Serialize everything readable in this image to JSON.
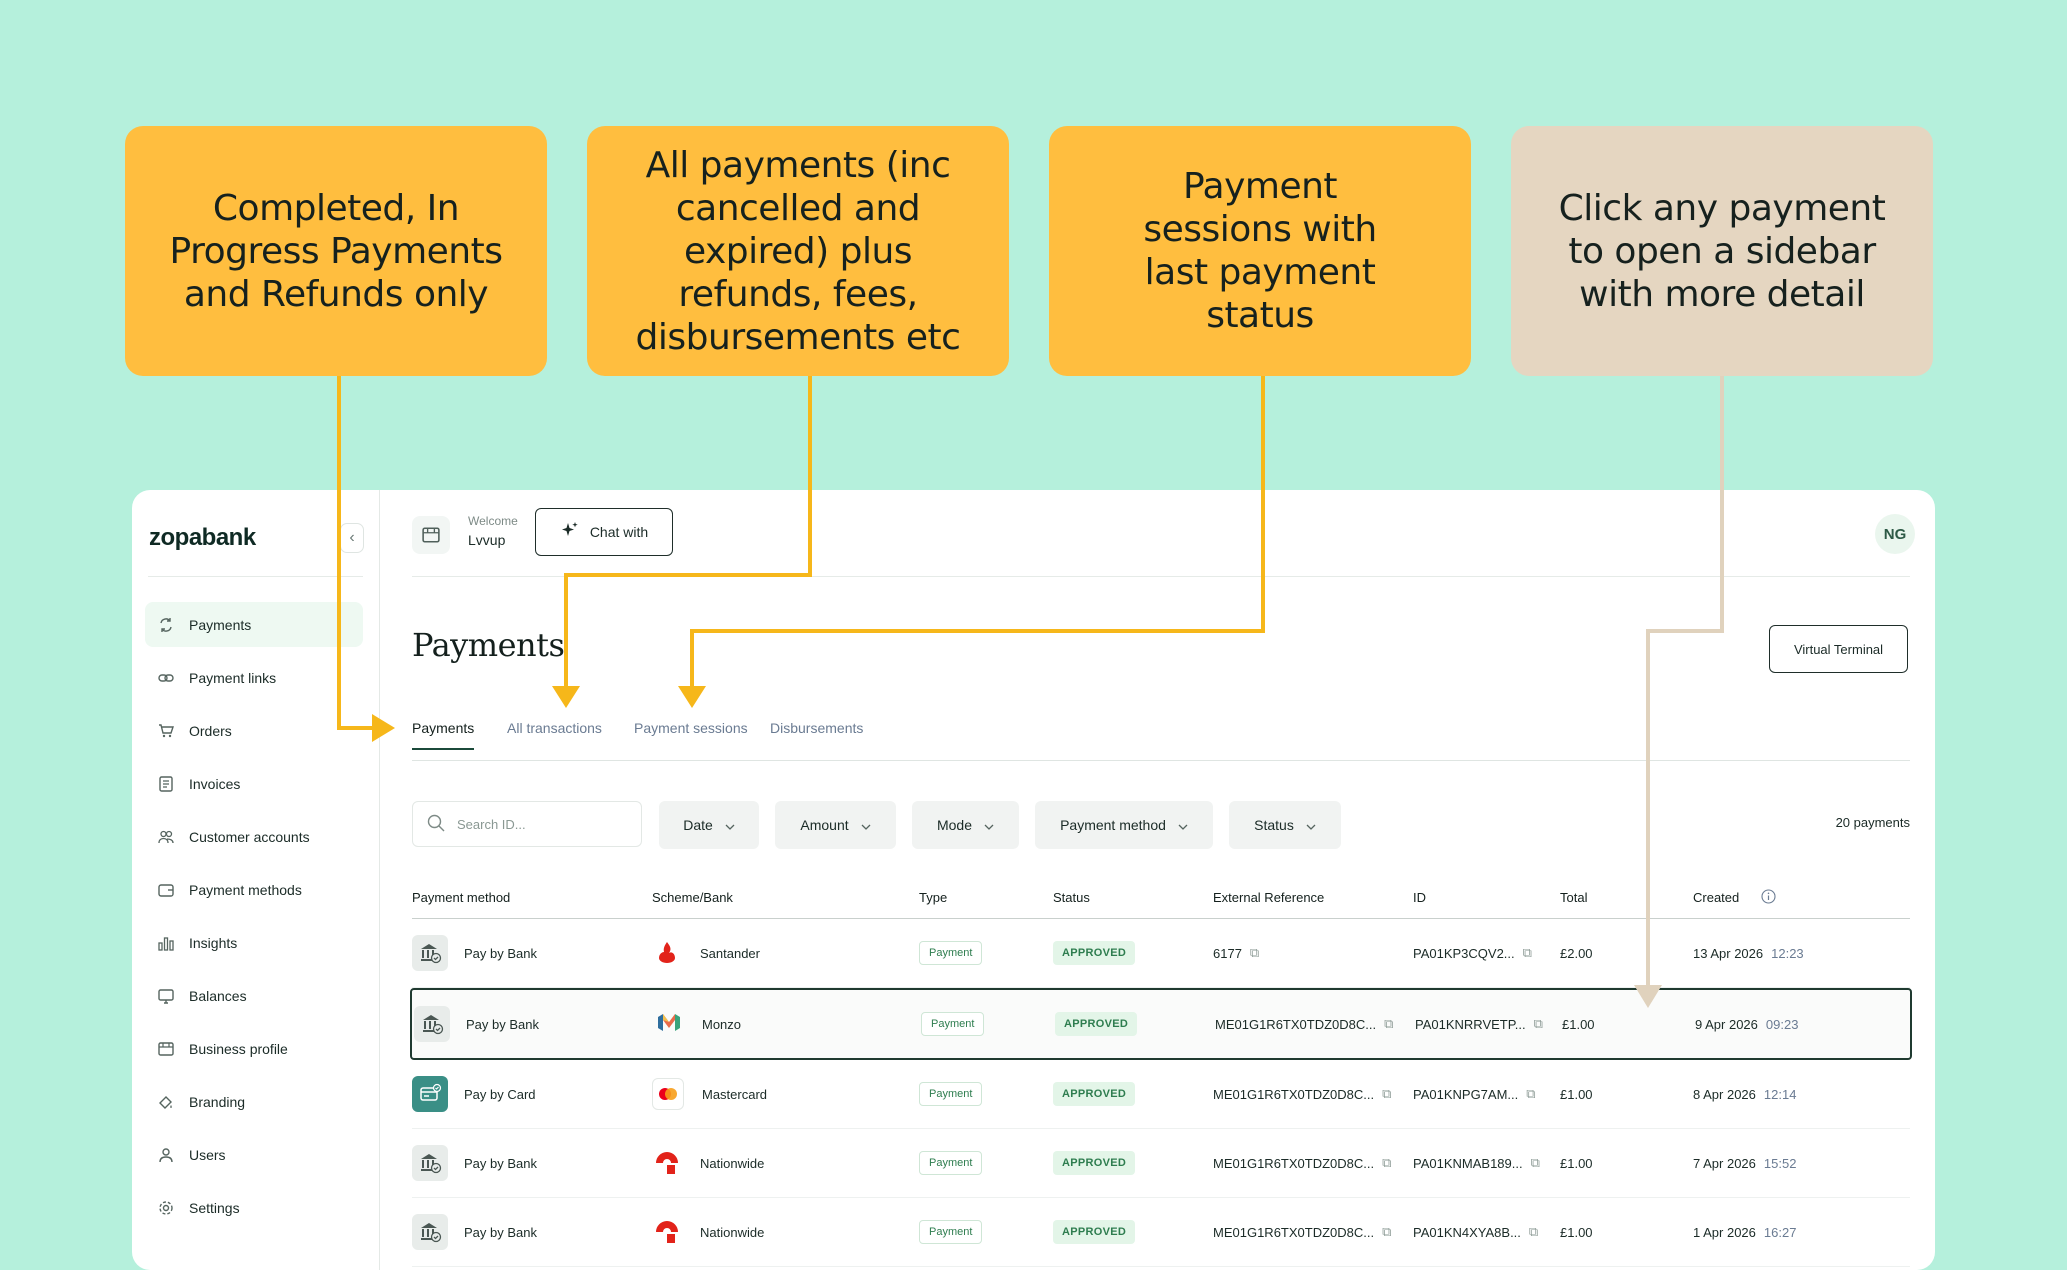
{
  "callouts": [
    {
      "text": "Completed, In Progress Payments and Refunds only",
      "color": "#ffbe3f"
    },
    {
      "text": "All payments (inc cancelled and expired) plus refunds, fees, disbursements etc",
      "color": "#ffbe3f"
    },
    {
      "text": "Payment sessions with last payment status",
      "color": "#ffbe3f"
    },
    {
      "text": "Click any payment to open a sidebar with more detail",
      "color": "#e5d6c1"
    }
  ],
  "sidebar": {
    "logo": "zopabank",
    "items": [
      {
        "label": "Payments",
        "icon": "payments-icon",
        "active": true
      },
      {
        "label": "Payment links",
        "icon": "link-icon"
      },
      {
        "label": "Orders",
        "icon": "cart-icon"
      },
      {
        "label": "Invoices",
        "icon": "invoice-icon"
      },
      {
        "label": "Customer accounts",
        "icon": "users-icon"
      },
      {
        "label": "Payment methods",
        "icon": "wallet-icon"
      },
      {
        "label": "Insights",
        "icon": "chart-icon"
      },
      {
        "label": "Balances",
        "icon": "balance-icon"
      },
      {
        "label": "Business profile",
        "icon": "store-icon"
      },
      {
        "label": "Branding",
        "icon": "paint-icon"
      },
      {
        "label": "Users",
        "icon": "user-icon"
      },
      {
        "label": "Settings",
        "icon": "gear-icon"
      }
    ]
  },
  "header": {
    "welcome": "Welcome",
    "company": "Lvvup",
    "chat_label": "Chat with",
    "avatar": "NG"
  },
  "page": {
    "title": "Payments",
    "virtual_terminal": "Virtual Terminal",
    "tabs": [
      "Payments",
      "All transactions",
      "Payment sessions",
      "Disbursements"
    ],
    "active_tab": "Payments"
  },
  "filters": {
    "search_placeholder": "Search ID...",
    "items": [
      "Date",
      "Amount",
      "Mode",
      "Payment method",
      "Status"
    ],
    "count": "20 payments"
  },
  "table": {
    "columns": [
      "Payment method",
      "Scheme/Bank",
      "Type",
      "Status",
      "External Reference",
      "ID",
      "Total",
      "Created"
    ],
    "rows": [
      {
        "method": "Pay by Bank",
        "bank": "Santander",
        "type": "Payment",
        "status": "APPROVED",
        "ext_ref": "6177",
        "id": "PA01KP3CQV2...",
        "total": "£2.00",
        "date": "13 Apr 2026",
        "time": "12:23"
      },
      {
        "method": "Pay by Bank",
        "bank": "Monzo",
        "type": "Payment",
        "status": "APPROVED",
        "ext_ref": "ME01G1R6TX0TDZ0D8C...",
        "id": "PA01KNRRVETP...",
        "total": "£1.00",
        "date": "9 Apr 2026",
        "time": "09:23"
      },
      {
        "method": "Pay by Card",
        "bank": "Mastercard",
        "type": "Payment",
        "status": "APPROVED",
        "ext_ref": "ME01G1R6TX0TDZ0D8C...",
        "id": "PA01KNPG7AM...",
        "total": "£1.00",
        "date": "8 Apr 2026",
        "time": "12:14"
      },
      {
        "method": "Pay by Bank",
        "bank": "Nationwide",
        "type": "Payment",
        "status": "APPROVED",
        "ext_ref": "ME01G1R6TX0TDZ0D8C...",
        "id": "PA01KNMAB189...",
        "total": "£1.00",
        "date": "7 Apr 2026",
        "time": "15:52"
      },
      {
        "method": "Pay by Bank",
        "bank": "Nationwide",
        "type": "Payment",
        "status": "APPROVED",
        "ext_ref": "ME01G1R6TX0TDZ0D8C...",
        "id": "PA01KN4XYA8B...",
        "total": "£1.00",
        "date": "1 Apr 2026",
        "time": "16:27"
      }
    ]
  },
  "colors": {
    "background": "#b5f0dc",
    "callout_yellow": "#ffbe3f",
    "callout_beige": "#e5d6c1",
    "arrow_yellow": "#f6b71a",
    "arrow_beige": "#e0d2bd",
    "accent": "#1b4a3a"
  }
}
